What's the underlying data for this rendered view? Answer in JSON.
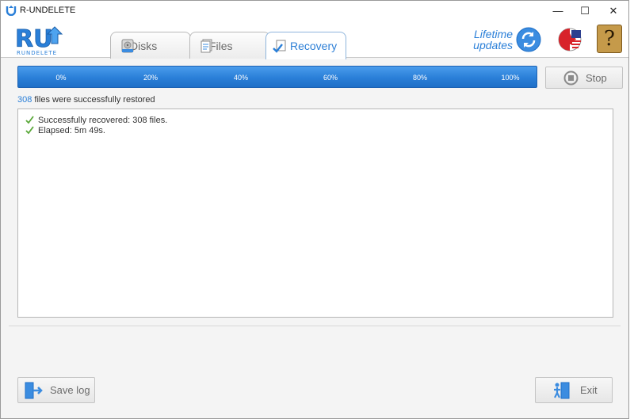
{
  "window": {
    "title": "R-UNDELETE",
    "minimize_glyph": "—",
    "maximize_glyph": "☐",
    "close_glyph": "✕"
  },
  "header": {
    "logo_text": "RUNDELETE",
    "tabs": [
      {
        "label": "Disks",
        "icon": "disk-icon",
        "active": false
      },
      {
        "label": "Files",
        "icon": "files-icon",
        "active": false
      },
      {
        "label": "Recovery",
        "icon": "recovery-icon",
        "active": true
      }
    ],
    "lifetime_line1": "Lifetime",
    "lifetime_line2": "updates",
    "help_glyph": "?"
  },
  "progress": {
    "ticks": [
      "0%",
      "20%",
      "40%",
      "60%",
      "80%",
      "100%"
    ],
    "fill": 1.0,
    "stop_label": "Stop"
  },
  "status": {
    "count": "308",
    "text": " files were successfully restored"
  },
  "log": [
    "Successfully recovered: 308 files.",
    "Elapsed: 5m 49s."
  ],
  "footer": {
    "save_label": "Save log",
    "exit_label": "Exit"
  },
  "colors": {
    "accent": "#2a7fd8",
    "check": "#5aa83a"
  }
}
